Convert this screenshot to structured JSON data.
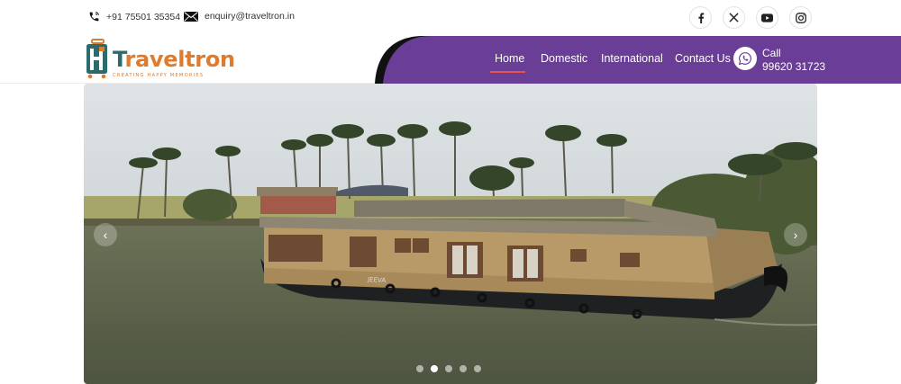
{
  "topbar": {
    "phone": "+91 75501 35354",
    "email": "enquiry@traveltron.in",
    "social": [
      {
        "name": "facebook-icon"
      },
      {
        "name": "x-twitter-icon"
      },
      {
        "name": "youtube-icon"
      },
      {
        "name": "instagram-icon"
      }
    ]
  },
  "brand": {
    "name_first": "T",
    "name_rest": "raveltron",
    "tagline": "CREATING HAPPY MEMORIES",
    "teal": "#2b6b6b",
    "orange": "#e07b2c"
  },
  "nav": {
    "items": [
      {
        "label": "Home",
        "active": true
      },
      {
        "label": "Domestic",
        "active": false
      },
      {
        "label": "International",
        "active": false
      },
      {
        "label": "Contact Us",
        "active": false
      }
    ],
    "bar_color": "#6a3d96",
    "active_underline_color": "#e8524a"
  },
  "call": {
    "label": "Call",
    "number": "99620 31723"
  },
  "slider": {
    "boat_name": "JEEVA",
    "prev_arrow": "‹",
    "next_arrow": "›",
    "slide_count": 5,
    "active_slide": 2
  }
}
